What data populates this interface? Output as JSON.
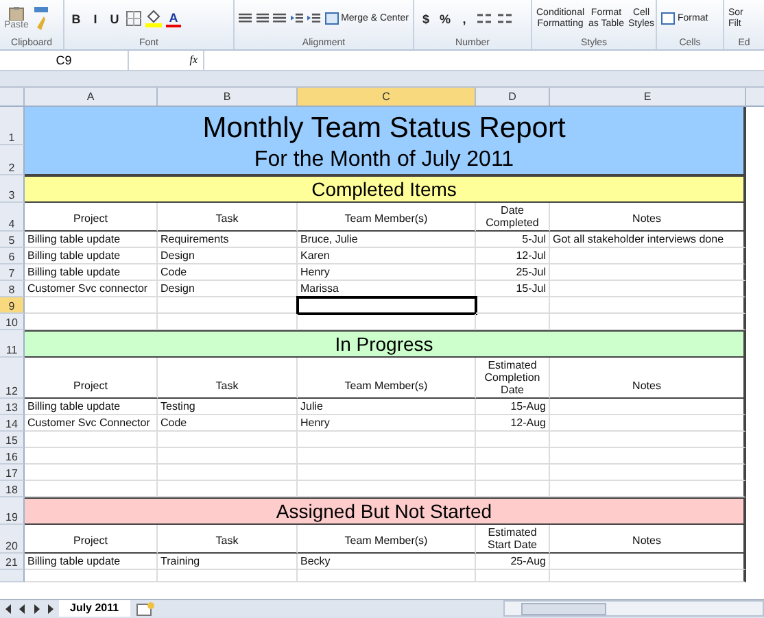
{
  "ribbon": {
    "groups": [
      {
        "label": "Clipboard",
        "items": [
          {
            "kind": "paste",
            "label": "Paste"
          },
          {
            "kind": "painter"
          }
        ]
      },
      {
        "label": "Font",
        "items": [
          {
            "kind": "char",
            "label": "B"
          },
          {
            "kind": "char",
            "label": "I"
          },
          {
            "kind": "char",
            "label": "U"
          },
          {
            "kind": "borders"
          },
          {
            "kind": "fill"
          },
          {
            "kind": "fontcolor",
            "label": "A"
          }
        ]
      },
      {
        "label": "Alignment",
        "items": [
          {
            "kind": "align"
          },
          {
            "kind": "align"
          },
          {
            "kind": "align"
          },
          {
            "kind": "indent"
          },
          {
            "kind": "indent"
          },
          {
            "kind": "merge",
            "label": "Merge & Center"
          }
        ]
      },
      {
        "label": "Number",
        "items": [
          {
            "kind": "char",
            "label": "$"
          },
          {
            "kind": "char",
            "label": "%"
          },
          {
            "kind": "char",
            "label": ","
          },
          {
            "kind": "decimal"
          },
          {
            "kind": "decimal"
          }
        ]
      },
      {
        "label": "Styles",
        "items": [
          {
            "kind": "twoline",
            "label": "Conditional",
            "label2": "Formatting"
          },
          {
            "kind": "twoline",
            "label": "Format",
            "label2": "as Table"
          },
          {
            "kind": "twoline",
            "label": "Cell",
            "label2": "Styles"
          }
        ]
      },
      {
        "label": "Cells",
        "items": [
          {
            "kind": "format",
            "label": "Format"
          }
        ]
      },
      {
        "label": "Ed",
        "items": [
          {
            "kind": "sort",
            "label": "Sor",
            "label2": "Filt"
          }
        ]
      }
    ]
  },
  "formula_bar": {
    "name_box": "C9",
    "fx": "fx"
  },
  "columns": [
    {
      "label": "A",
      "selected": false
    },
    {
      "label": "B",
      "selected": false
    },
    {
      "label": "C",
      "selected": true
    },
    {
      "label": "D",
      "selected": false
    },
    {
      "label": "E",
      "selected": false
    }
  ],
  "rows": [
    {
      "number": "1",
      "kind": "title",
      "text": "Monthly Team Status Report",
      "color": "#99ccff",
      "selected": false
    },
    {
      "number": "2",
      "kind": "subtitle",
      "text": "For the Month of July 2011",
      "color": "#99ccff",
      "selected": false
    },
    {
      "number": "3",
      "kind": "section",
      "text": "Completed Items",
      "color": "#ffff99",
      "selected": false
    },
    {
      "number": "4",
      "kind": "header",
      "labels": [
        "Project",
        "Task",
        "Team Member(s)",
        "Date Completed",
        "Notes"
      ],
      "selected": false
    },
    {
      "number": "5",
      "kind": "data",
      "project": "Billing table update",
      "task": "Requirements",
      "members": "Bruce, Julie",
      "date": "5-Jul",
      "notes": "Got all stakeholder interviews done",
      "selected": false
    },
    {
      "number": "6",
      "kind": "data",
      "project": "Billing table update",
      "task": "Design",
      "members": "Karen",
      "date": "12-Jul",
      "selected": false
    },
    {
      "number": "7",
      "kind": "data",
      "project": "Billing table update",
      "task": "Code",
      "members": "Henry",
      "date": "25-Jul",
      "selected": false
    },
    {
      "number": "8",
      "kind": "data",
      "project": "Customer Svc connector",
      "task": "Design",
      "members": "Marissa",
      "date": "15-Jul",
      "selected": false
    },
    {
      "number": "9",
      "kind": "data",
      "selected": true
    },
    {
      "number": "10",
      "kind": "data",
      "selected": false
    },
    {
      "number": "11",
      "kind": "section",
      "text": "In Progress",
      "color": "#ccffcc",
      "selected": false
    },
    {
      "number": "12",
      "kind": "header",
      "labels": [
        "Project",
        "Task",
        "Team Member(s)",
        "Estimated Completion Date",
        "Notes"
      ],
      "selected": false
    },
    {
      "number": "13",
      "kind": "data",
      "project": "Billing table update",
      "task": "Testing",
      "members": "Julie",
      "date": "15-Aug",
      "selected": false
    },
    {
      "number": "14",
      "kind": "data",
      "project": "Customer Svc Connector",
      "task": "Code",
      "members": "Henry",
      "date": "12-Aug",
      "selected": false
    },
    {
      "number": "15",
      "kind": "data",
      "selected": false
    },
    {
      "number": "16",
      "kind": "data",
      "selected": false
    },
    {
      "number": "17",
      "kind": "data",
      "selected": false
    },
    {
      "number": "18",
      "kind": "data",
      "selected": false
    },
    {
      "number": "19",
      "kind": "section",
      "text": "Assigned But Not Started",
      "color": "#ffcccc",
      "selected": false
    },
    {
      "number": "20",
      "kind": "header",
      "labels": [
        "Project",
        "Task",
        "Team Member(s)",
        "Estimated Start Date",
        "Notes"
      ],
      "selected": false
    },
    {
      "number": "21",
      "kind": "data",
      "project": "Billing table update",
      "task": "Training",
      "members": "Becky",
      "date": "25-Aug",
      "selected": false
    }
  ],
  "sheet_tabs": [
    {
      "label": "July 2011",
      "selected": true
    }
  ]
}
